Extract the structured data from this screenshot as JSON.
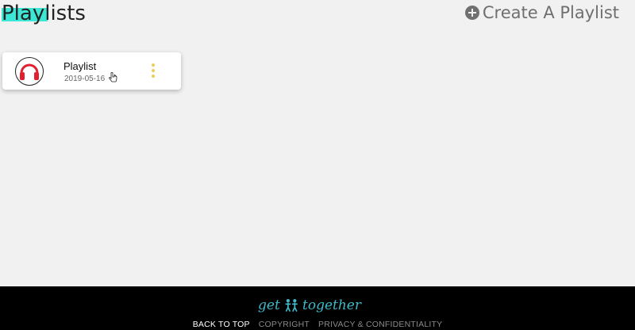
{
  "header": {
    "title": "Playlists",
    "create_label": "Create A Playlist"
  },
  "playlists": [
    {
      "name": "Playlist",
      "date": "2019-05-16",
      "icon": "headphones-icon"
    }
  ],
  "footer": {
    "brand_left": "get",
    "brand_right": "together",
    "links": [
      "BACK TO TOP",
      "COPYRIGHT",
      "PRIVACY & CONFIDENTIALITY"
    ]
  },
  "colors": {
    "title_highlight": "#3de7d6",
    "menu_dots": "#e9cf56",
    "headphones": "#e0202f",
    "brand": "#3fb8c8"
  }
}
